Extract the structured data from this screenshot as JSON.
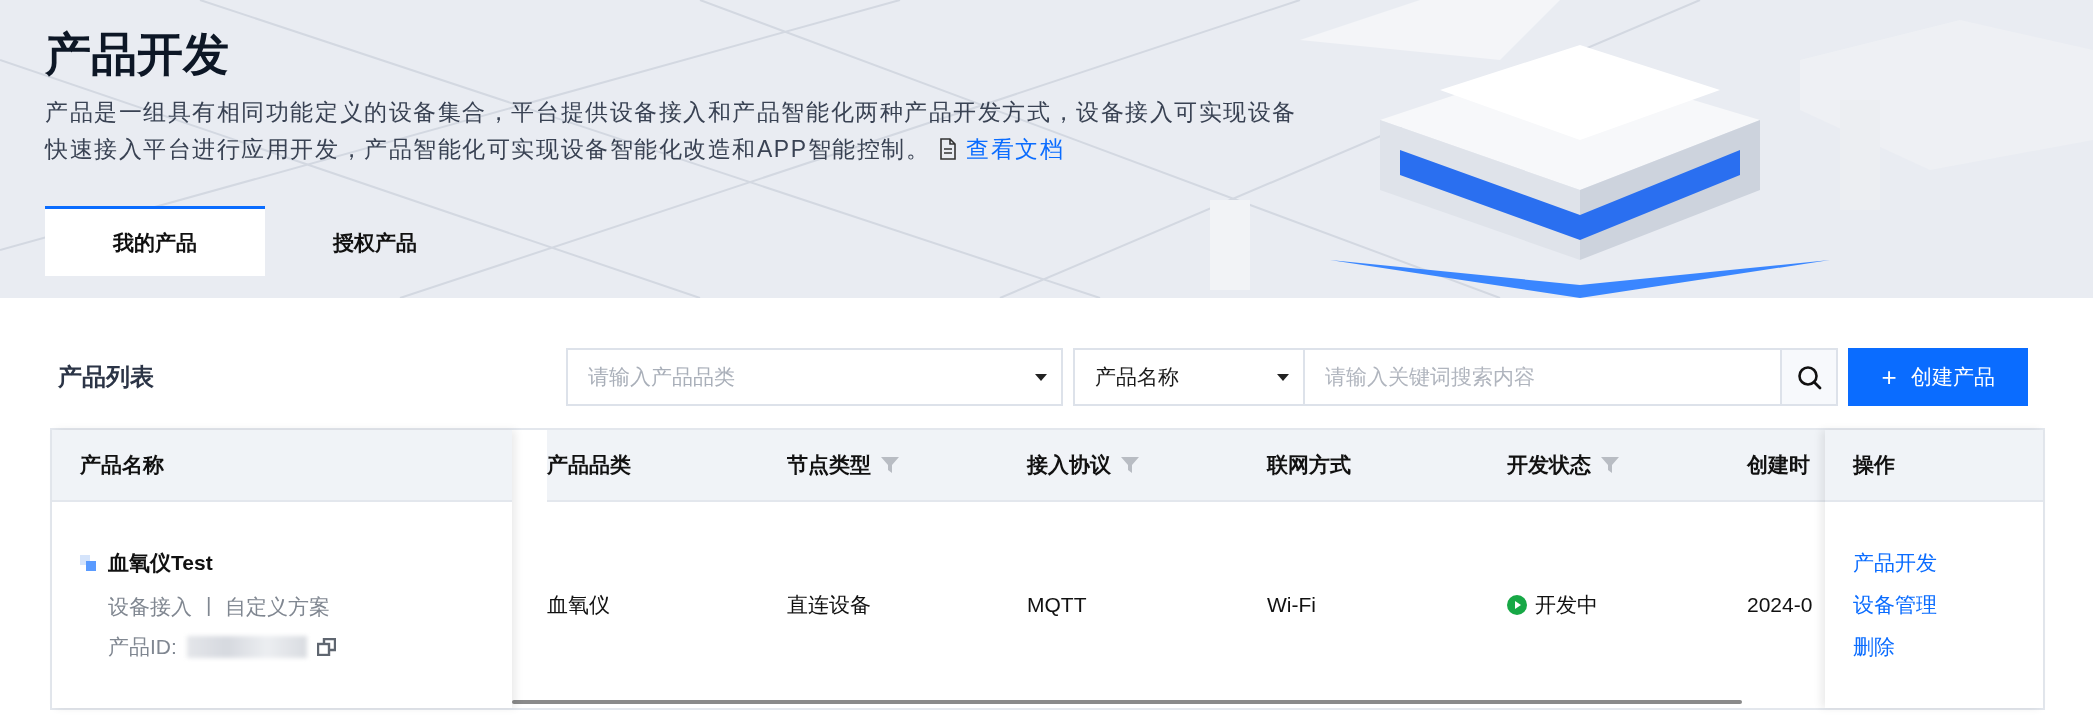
{
  "header": {
    "title": "产品开发",
    "description": "产品是一组具有相同功能定义的设备集合，平台提供设备接入和产品智能化两种产品开发方式，设备接入可实现设备快速接入平台进行应用开发，产品智能化可实现设备智能化改造和APP智能控制。",
    "doc_link": "查看文档"
  },
  "tabs": [
    {
      "label": "我的产品",
      "selected": true
    },
    {
      "label": "授权产品",
      "selected": false
    }
  ],
  "toolbar": {
    "title": "产品列表",
    "category_filter": {
      "placeholder": "请输入产品品类"
    },
    "field_select": {
      "value": "产品名称"
    },
    "search": {
      "placeholder": "请输入关键词搜索内容"
    },
    "create_button": {
      "icon": "+",
      "label": "创建产品"
    }
  },
  "table": {
    "columns": [
      {
        "label": "产品名称",
        "filterable": false
      },
      {
        "label": "产品品类",
        "filterable": false
      },
      {
        "label": "节点类型",
        "filterable": true
      },
      {
        "label": "接入协议",
        "filterable": true
      },
      {
        "label": "联网方式",
        "filterable": false
      },
      {
        "label": "开发状态",
        "filterable": true
      },
      {
        "label": "创建时",
        "filterable": false
      },
      {
        "label": "操作",
        "filterable": false
      }
    ],
    "rows": [
      {
        "name": "血氧仪Test",
        "links": [
          "设备接入",
          "自定义方案"
        ],
        "separator": "|",
        "id_label": "产品ID:",
        "category": "血氧仪",
        "node_type": "直连设备",
        "protocol": "MQTT",
        "network": "Wi-Fi",
        "status": {
          "label": "开发中",
          "kind": "developing"
        },
        "created": "2024-0",
        "actions": [
          "产品开发",
          "设备管理",
          "删除"
        ]
      }
    ]
  }
}
